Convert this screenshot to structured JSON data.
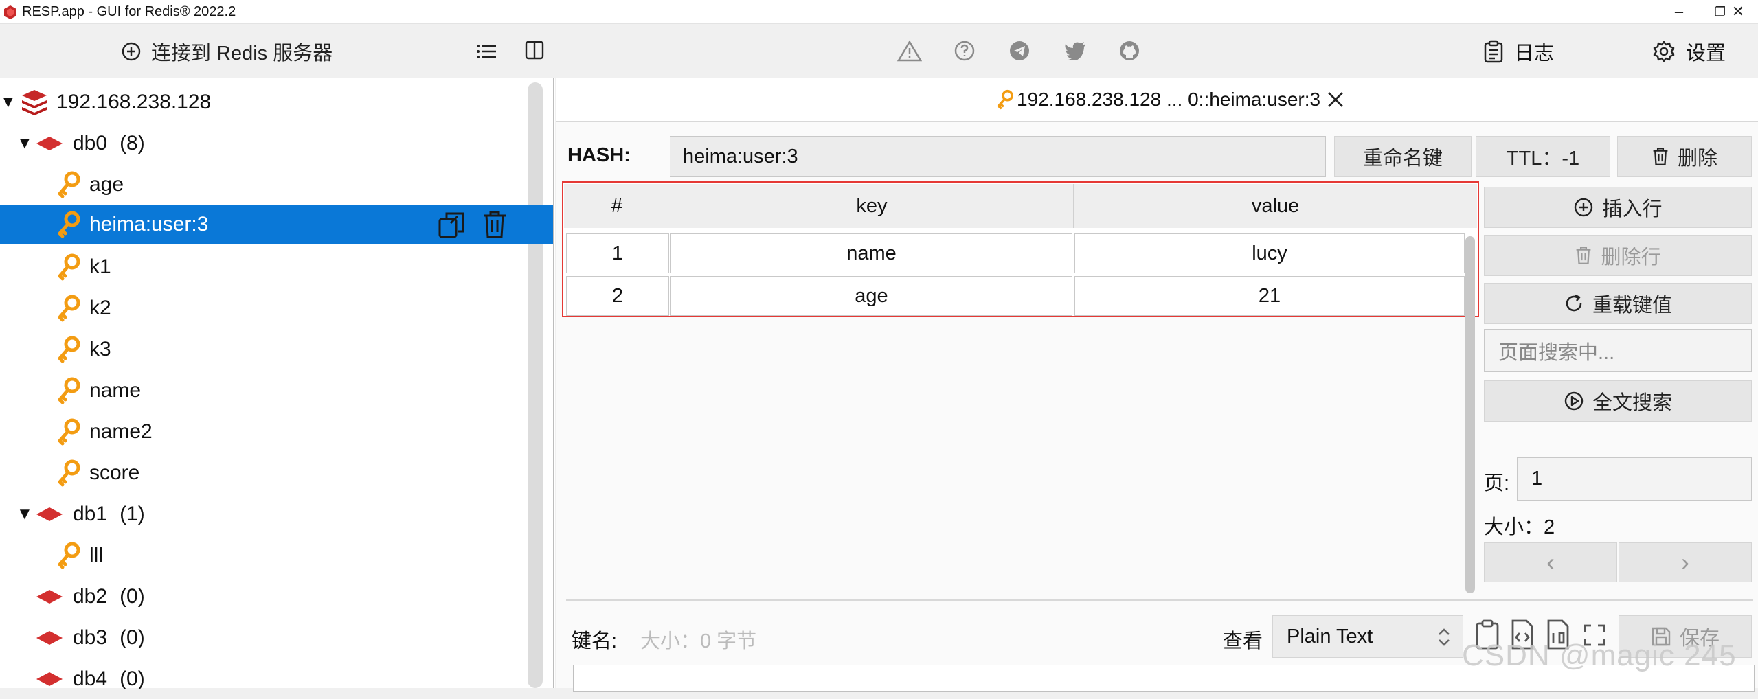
{
  "window": {
    "title": "RESP.app - GUI for Redis® 2022.2",
    "controls": {
      "minimize": "–",
      "restore": "❐",
      "close": "✕"
    }
  },
  "left_toolbar": {
    "connect_label": "连接到 Redis 服务器"
  },
  "right_toolbar": {
    "log_label": "日志",
    "settings_label": "设置"
  },
  "tree": {
    "server": "192.168.238.128",
    "db0": {
      "name": "db0",
      "count": "(8)"
    },
    "db0_keys": [
      "age",
      "heima:user:3",
      "k1",
      "k2",
      "k3",
      "name",
      "name2",
      "score"
    ],
    "db1": {
      "name": "db1",
      "count": "(1)"
    },
    "db1_keys": [
      "lll"
    ],
    "db2": {
      "name": "db2",
      "count": "(0)"
    },
    "db3": {
      "name": "db3",
      "count": "(0)"
    },
    "db4": {
      "name": "db4",
      "count": "(0)"
    }
  },
  "tab": {
    "label": "192.168.238.128 ... 0::heima:user:3"
  },
  "key_view": {
    "type_label": "HASH:",
    "key_name": "heima:user:3",
    "rename_label": "重命名键",
    "ttl_label": "TTL：-1",
    "delete_label": "删除"
  },
  "table": {
    "headers": [
      "#",
      "key",
      "value"
    ],
    "rows": [
      {
        "index": "1",
        "key": "name",
        "value": "lucy"
      },
      {
        "index": "2",
        "key": "age",
        "value": "21"
      }
    ]
  },
  "side_actions": {
    "insert_row": "插入行",
    "delete_row": "删除行",
    "reload": "重载键值",
    "search_placeholder": "页面搜索中...",
    "fulltext_search": "全文搜索",
    "page_label": "页:",
    "page_value": "1",
    "size_label": "大小：2",
    "prev": "‹",
    "next": "›"
  },
  "value_editor": {
    "key_label": "键名:",
    "size_hint": "大小：0 字节",
    "view_label": "查看",
    "format": "Plain Text",
    "save_label": "保存"
  },
  "watermark": "CSDN @magic 245",
  "colors": {
    "selection": "#0a78d7",
    "key_icon": "#f39c12",
    "db_icon": "#d32f2f",
    "highlight_border": "#e53935"
  }
}
